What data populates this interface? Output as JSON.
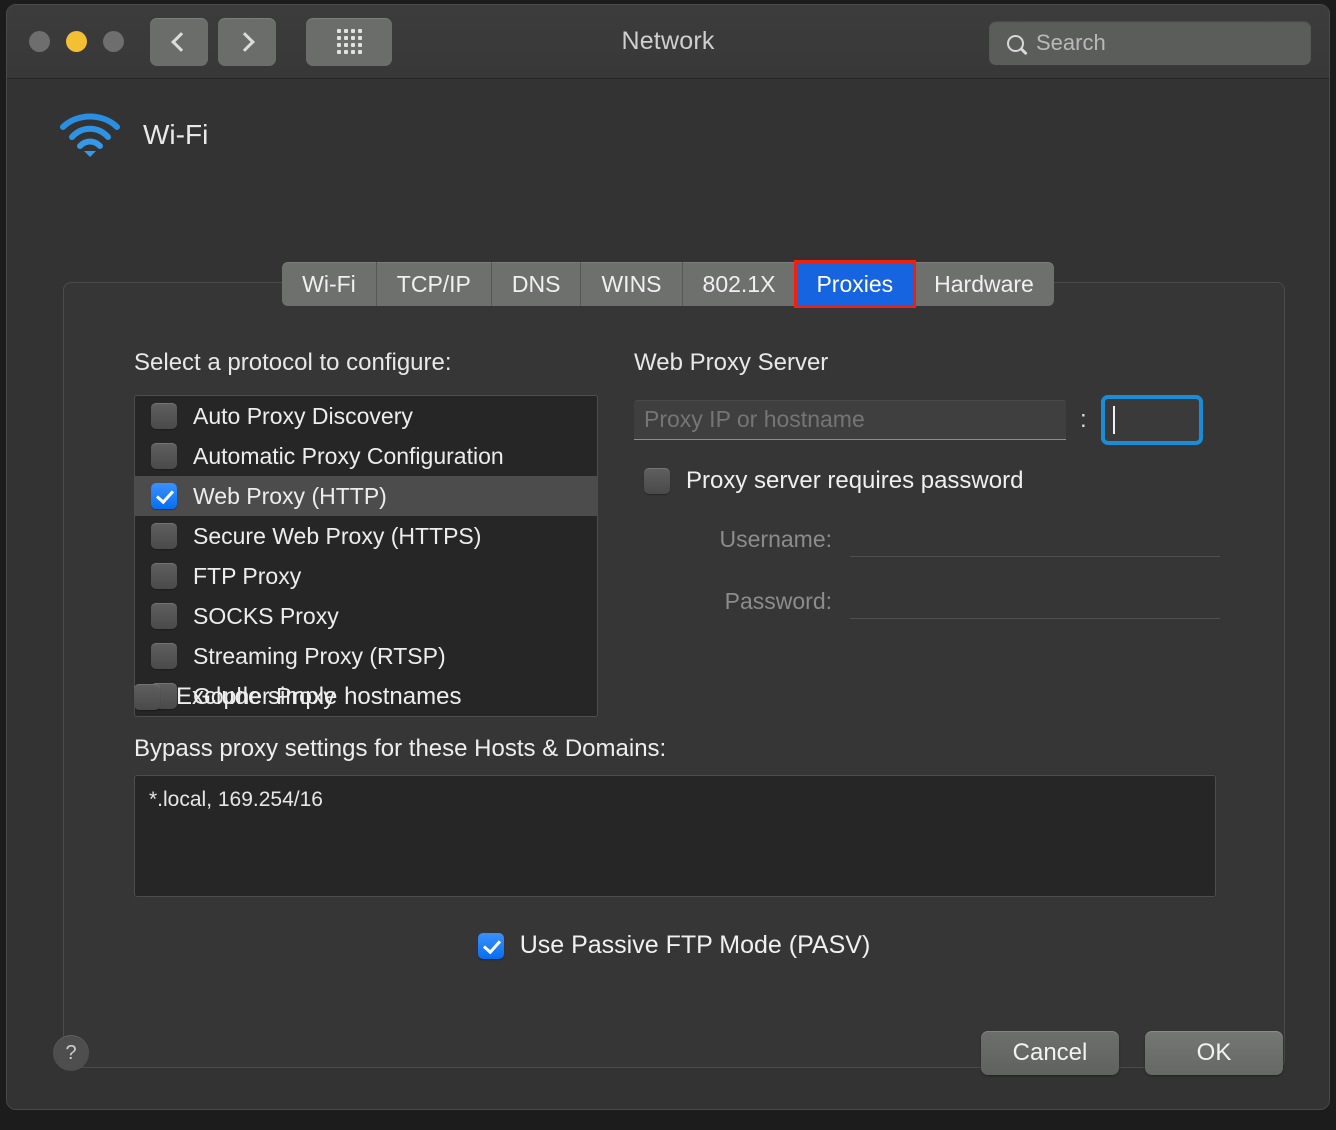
{
  "window": {
    "title": "Network",
    "traffic_lights": [
      "close",
      "minimize",
      "zoom"
    ]
  },
  "toolbar": {
    "back_icon": "chevron-left-icon",
    "forward_icon": "chevron-right-icon",
    "grid_icon": "show-all-grid-icon",
    "search_placeholder": "Search",
    "search_value": "",
    "search_icon": "search-icon"
  },
  "service": {
    "icon": "wifi-icon",
    "name": "Wi-Fi"
  },
  "tabs": [
    {
      "label": "Wi-Fi",
      "active": false
    },
    {
      "label": "TCP/IP",
      "active": false
    },
    {
      "label": "DNS",
      "active": false
    },
    {
      "label": "WINS",
      "active": false
    },
    {
      "label": "802.1X",
      "active": false
    },
    {
      "label": "Proxies",
      "active": true
    },
    {
      "label": "Hardware",
      "active": false
    }
  ],
  "protocols": {
    "heading": "Select a protocol to configure:",
    "items": [
      {
        "label": "Auto Proxy Discovery",
        "checked": false,
        "selected": false
      },
      {
        "label": "Automatic Proxy Configuration",
        "checked": false,
        "selected": false
      },
      {
        "label": "Web Proxy (HTTP)",
        "checked": true,
        "selected": true
      },
      {
        "label": "Secure Web Proxy (HTTPS)",
        "checked": false,
        "selected": false
      },
      {
        "label": "FTP Proxy",
        "checked": false,
        "selected": false
      },
      {
        "label": "SOCKS Proxy",
        "checked": false,
        "selected": false
      },
      {
        "label": "Streaming Proxy (RTSP)",
        "checked": false,
        "selected": false
      },
      {
        "label": "Gopher Proxy",
        "checked": false,
        "selected": false
      }
    ]
  },
  "exclude_simple_hostnames": {
    "label": "Exclude simple hostnames",
    "checked": false
  },
  "bypass": {
    "label": "Bypass proxy settings for these Hosts & Domains:",
    "value": "*.local, 169.254/16"
  },
  "passive_ftp": {
    "label": "Use Passive FTP Mode (PASV)",
    "checked": true
  },
  "web_proxy_server": {
    "heading": "Web Proxy Server",
    "host_placeholder": "Proxy IP or hostname",
    "host_value": "",
    "separator": ":",
    "port_value": "",
    "port_focused": true,
    "requires_password": {
      "label": "Proxy server requires password",
      "checked": false
    },
    "username_label": "Username:",
    "username_value": "",
    "password_label": "Password:",
    "password_value": ""
  },
  "footer": {
    "help_label": "?",
    "cancel_label": "Cancel",
    "ok_label": "OK"
  },
  "colors": {
    "accent_blue": "#1664e0",
    "checkbox_blue": "#0a72f0",
    "focus_ring": "#1a8cd8",
    "annotation_red": "#f21f0c",
    "wifi_blue": "#2a8fe0",
    "window_bg": "#333333",
    "panel_bg": "#363636",
    "list_bg": "#262626"
  }
}
